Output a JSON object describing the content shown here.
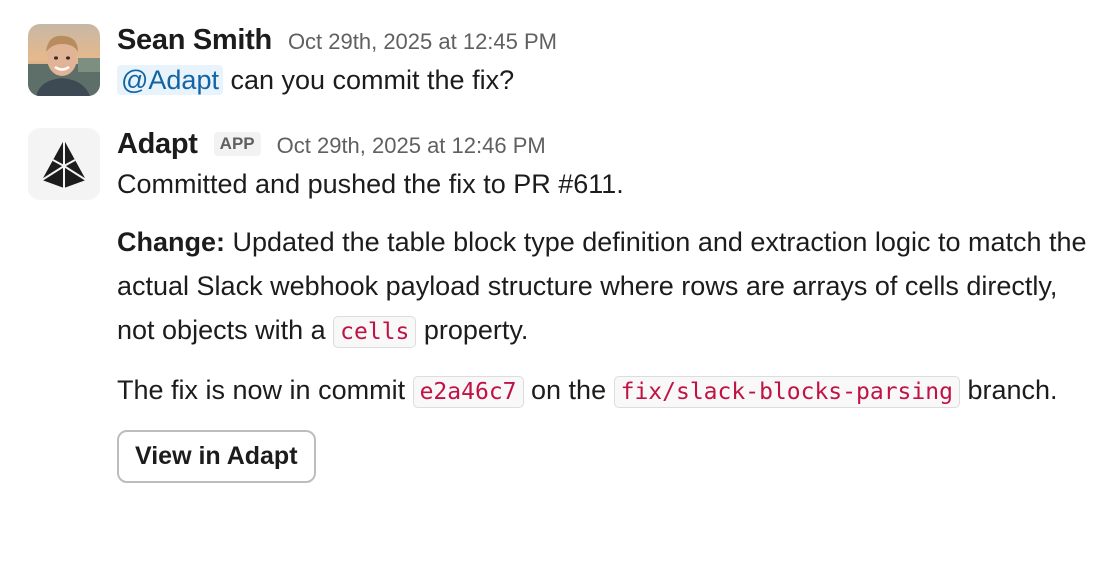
{
  "messages": [
    {
      "sender": "Sean Smith",
      "timestamp": "Oct 29th, 2025 at 12:45 PM",
      "avatar_icon": "user-photo-avatar",
      "mention": "@Adapt",
      "text": " can you commit the fix?"
    },
    {
      "sender": "Adapt",
      "badge": "APP",
      "timestamp": "Oct 29th, 2025 at 12:46 PM",
      "avatar_icon": "adapt-logo-icon",
      "line1": "Committed and pushed the fix to PR #611.",
      "change_label": "Change:",
      "change_text": " Updated the table block type definition and extraction logic to match the actual Slack webhook payload structure where rows are arrays of cells directly, not objects with a ",
      "change_code": "cells",
      "change_tail": " property.",
      "commit_text_1": "The fix is now in commit ",
      "commit_hash": "e2a46c7",
      "commit_text_2": " on the ",
      "branch_name": "fix/slack-blocks-parsing",
      "commit_text_3": " branch.",
      "button_label": "View in Adapt"
    }
  ],
  "colors": {
    "mention": "#1264a3",
    "code": "#c01343",
    "timestamp": "#616061"
  }
}
